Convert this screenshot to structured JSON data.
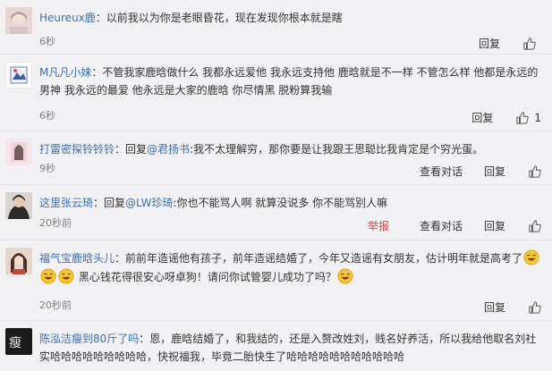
{
  "comments": [
    {
      "name": "Heureux鹿",
      "text": "：以前我以为你是老眼昏花，现在发现你根本就是瞎",
      "time": "6秒",
      "reply": "回复",
      "like_count": ""
    },
    {
      "name": "M凡凡小妹",
      "text": "：不管我家鹿晗做什么 我都永远爱他 我永远支持他 鹿晗就是不一样 不管怎么样 他都是永远的男神 我永远的最爱 他永远是大家的鹿晗 你尽情黑 脱粉算我输",
      "time": "6秒",
      "reply": "回复",
      "like_count": "1"
    },
    {
      "name": "打雷密探铃铃铃",
      "prefix": "：回复",
      "mention": "@君扬书",
      "text": ":我不太理解穷，那你要是让我跟王思聪比我肯定是个穷光蛋。",
      "time": "9秒",
      "view": "查看对话",
      "reply": "回复"
    },
    {
      "name": "这里张云琦",
      "prefix": "：回复",
      "mention": "@LW珍琦",
      "text": ":你也不能骂人啊 就算没说多 你不能骂别人嘛",
      "time": "20秒前",
      "report": "举报",
      "view": "查看对话",
      "reply": "回复"
    },
    {
      "name": "福气宝鹿晗头儿",
      "text1": "：前前年造谣他有孩子，前年造谣结婚了，今年又造谣有女朋友，估计明年就是高考了",
      "text2": " 黑心钱花得很安心呀卓狗！请问你试管婴儿成功了吗？",
      "time": "20秒前",
      "reply": "回复"
    },
    {
      "name": "陈泓洁瘦到80斤了吗",
      "text": "：恩，鹿晗结婚了，和我结的，还是入赘改姓刘，贱名好养活，所以我给他取名刘社实哈哈哈哈哈哈哈哈哈，快祝福我，毕竟二胎快生了哈哈哈哈哈哈哈哈哈哈哈"
    }
  ],
  "icons": {
    "like": "thumbs-up-icon",
    "emoji": "laughing-emoji-icon"
  },
  "colors": {
    "link": "#3b6fb6",
    "report": "#e8433a",
    "time": "#808080"
  }
}
